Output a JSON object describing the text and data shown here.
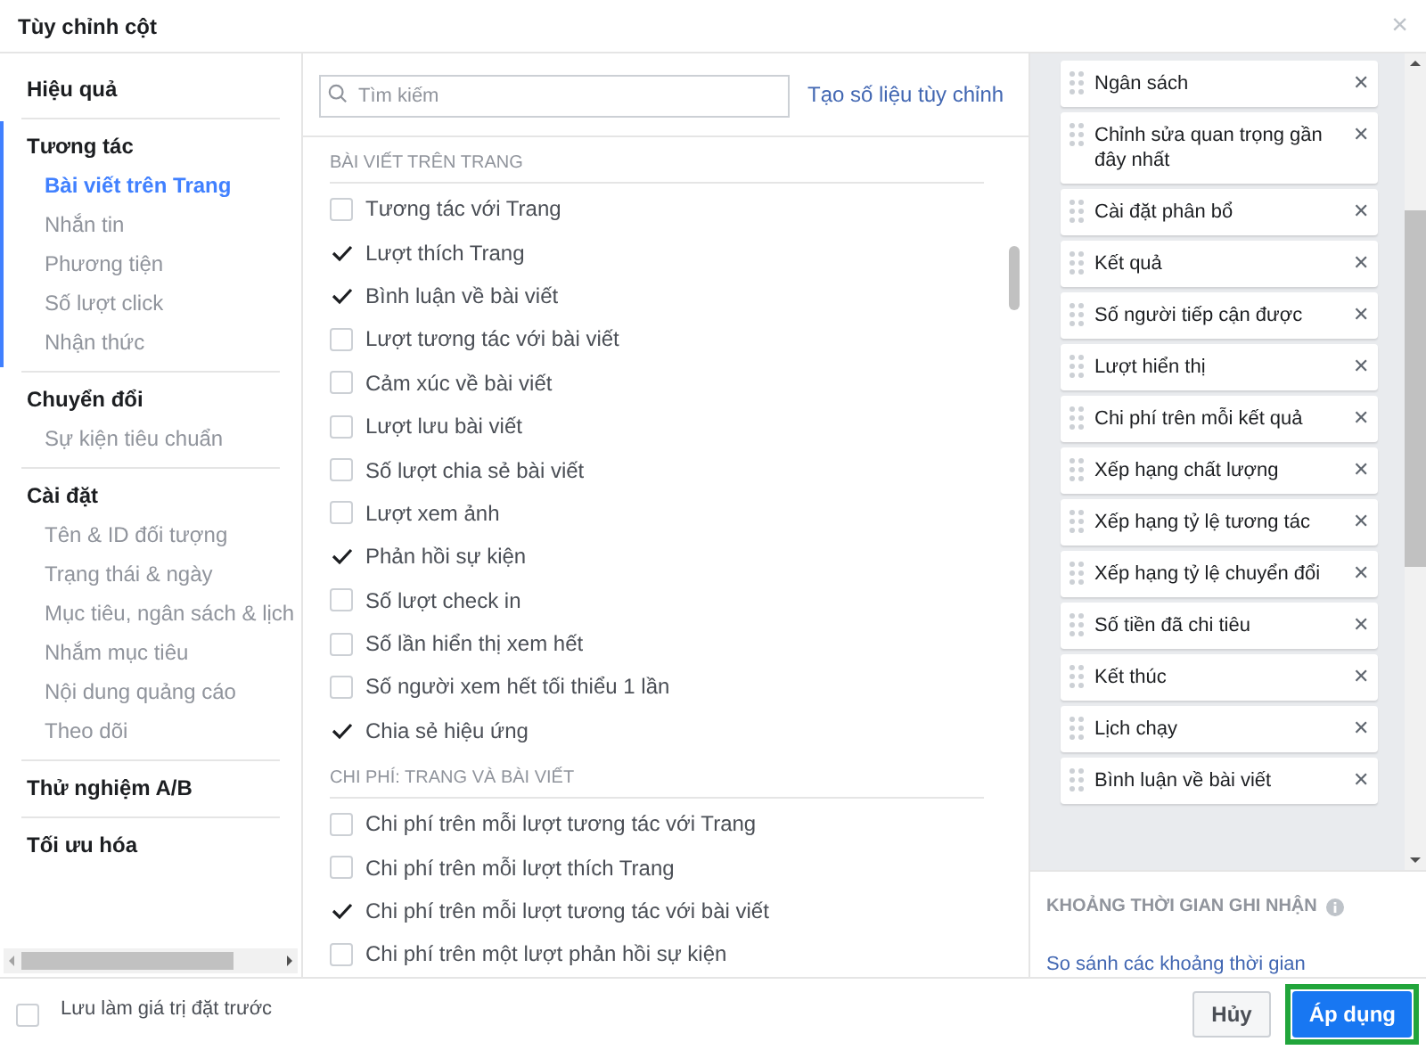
{
  "window": {
    "title": "Tùy chỉnh cột",
    "close": "×"
  },
  "sidebar": {
    "sections": [
      {
        "title": "Hiệu quả",
        "active": false
      },
      {
        "title": "Tương tác",
        "active": true,
        "items": [
          {
            "label": "Bài viết trên Trang",
            "selected": true
          },
          {
            "label": "Nhắn tin",
            "selected": false
          },
          {
            "label": "Phương tiện",
            "selected": false
          },
          {
            "label": "Số lượt click",
            "selected": false
          },
          {
            "label": "Nhận thức",
            "selected": false
          }
        ]
      },
      {
        "title": "Chuyển đổi",
        "active": false,
        "items": [
          {
            "label": "Sự kiện tiêu chuẩn",
            "selected": false
          }
        ]
      },
      {
        "title": "Cài đặt",
        "active": false,
        "items": [
          {
            "label": "Tên & ID đối tượng",
            "selected": false
          },
          {
            "label": "Trạng thái & ngày",
            "selected": false
          },
          {
            "label": "Mục tiêu, ngân sách & lịch",
            "selected": false
          },
          {
            "label": "Nhắm mục tiêu",
            "selected": false
          },
          {
            "label": "Nội dung quảng cáo",
            "selected": false
          },
          {
            "label": "Theo dõi",
            "selected": false
          }
        ]
      },
      {
        "title": "Thử nghiệm A/B",
        "active": false
      },
      {
        "title": "Tối ưu hóa",
        "active": false
      }
    ]
  },
  "search": {
    "placeholder": "Tìm kiếm"
  },
  "custom_metric_link": "Tạo số liệu tùy chỉnh",
  "metric_groups": [
    {
      "heading": "BÀI VIẾT TRÊN TRANG",
      "items": [
        {
          "label": "Tương tác với Trang",
          "checked": false
        },
        {
          "label": "Lượt thích Trang",
          "checked": true
        },
        {
          "label": "Bình luận về bài viết",
          "checked": true
        },
        {
          "label": "Lượt tương tác với bài viết",
          "checked": false
        },
        {
          "label": "Cảm xúc về bài viết",
          "checked": false
        },
        {
          "label": "Lượt lưu bài viết",
          "checked": false
        },
        {
          "label": "Số lượt chia sẻ bài viết",
          "checked": false
        },
        {
          "label": "Lượt xem ảnh",
          "checked": false
        },
        {
          "label": "Phản hồi sự kiện",
          "checked": true
        },
        {
          "label": "Số lượt check in",
          "checked": false
        },
        {
          "label": "Số lần hiển thị xem hết",
          "checked": false
        },
        {
          "label": "Số người xem hết tối thiểu 1 lần",
          "checked": false
        },
        {
          "label": "Chia sẻ hiệu ứng",
          "checked": true
        }
      ]
    },
    {
      "heading": "CHI PHÍ: TRANG VÀ BÀI VIẾT",
      "items": [
        {
          "label": "Chi phí trên mỗi lượt tương tác với Trang",
          "checked": false
        },
        {
          "label": "Chi phí trên mỗi lượt thích Trang",
          "checked": false
        },
        {
          "label": "Chi phí trên mỗi lượt tương tác với bài viết",
          "checked": true
        },
        {
          "label": "Chi phí trên một lượt phản hồi sự kiện",
          "checked": false
        }
      ]
    }
  ],
  "selected_columns": [
    {
      "label": "Ngân sách",
      "remove": "✕"
    },
    {
      "label": "Chỉnh sửa quan trọng gần đây nhất",
      "remove": "✕"
    },
    {
      "label": "Cài đặt phân bổ",
      "remove": "✕"
    },
    {
      "label": "Kết quả",
      "remove": "✕"
    },
    {
      "label": "Số người tiếp cận được",
      "remove": "✕"
    },
    {
      "label": "Lượt hiển thị",
      "remove": "✕"
    },
    {
      "label": "Chi phí trên mỗi kết quả",
      "remove": "✕"
    },
    {
      "label": "Xếp hạng chất lượng",
      "remove": "✕"
    },
    {
      "label": "Xếp hạng tỷ lệ tương tác",
      "remove": "✕"
    },
    {
      "label": "Xếp hạng tỷ lệ chuyển đổi",
      "remove": "✕"
    },
    {
      "label": "Số tiền đã chi tiêu",
      "remove": "✕"
    },
    {
      "label": "Kết thúc",
      "remove": "✕"
    },
    {
      "label": "Lịch chạy",
      "remove": "✕"
    },
    {
      "label": "Bình luận về bài viết",
      "remove": "✕"
    }
  ],
  "attribution": {
    "heading": "KHOẢNG THỜI GIAN GHI NHẬN",
    "link": "So sánh các khoảng thời gian"
  },
  "footer": {
    "save_preset": {
      "label": "Lưu làm giá trị đặt trước",
      "checked": false
    },
    "buttons": [
      {
        "label": "Hủy",
        "kind": "secondary"
      },
      {
        "label": "Áp dụng",
        "kind": "primary"
      }
    ]
  }
}
